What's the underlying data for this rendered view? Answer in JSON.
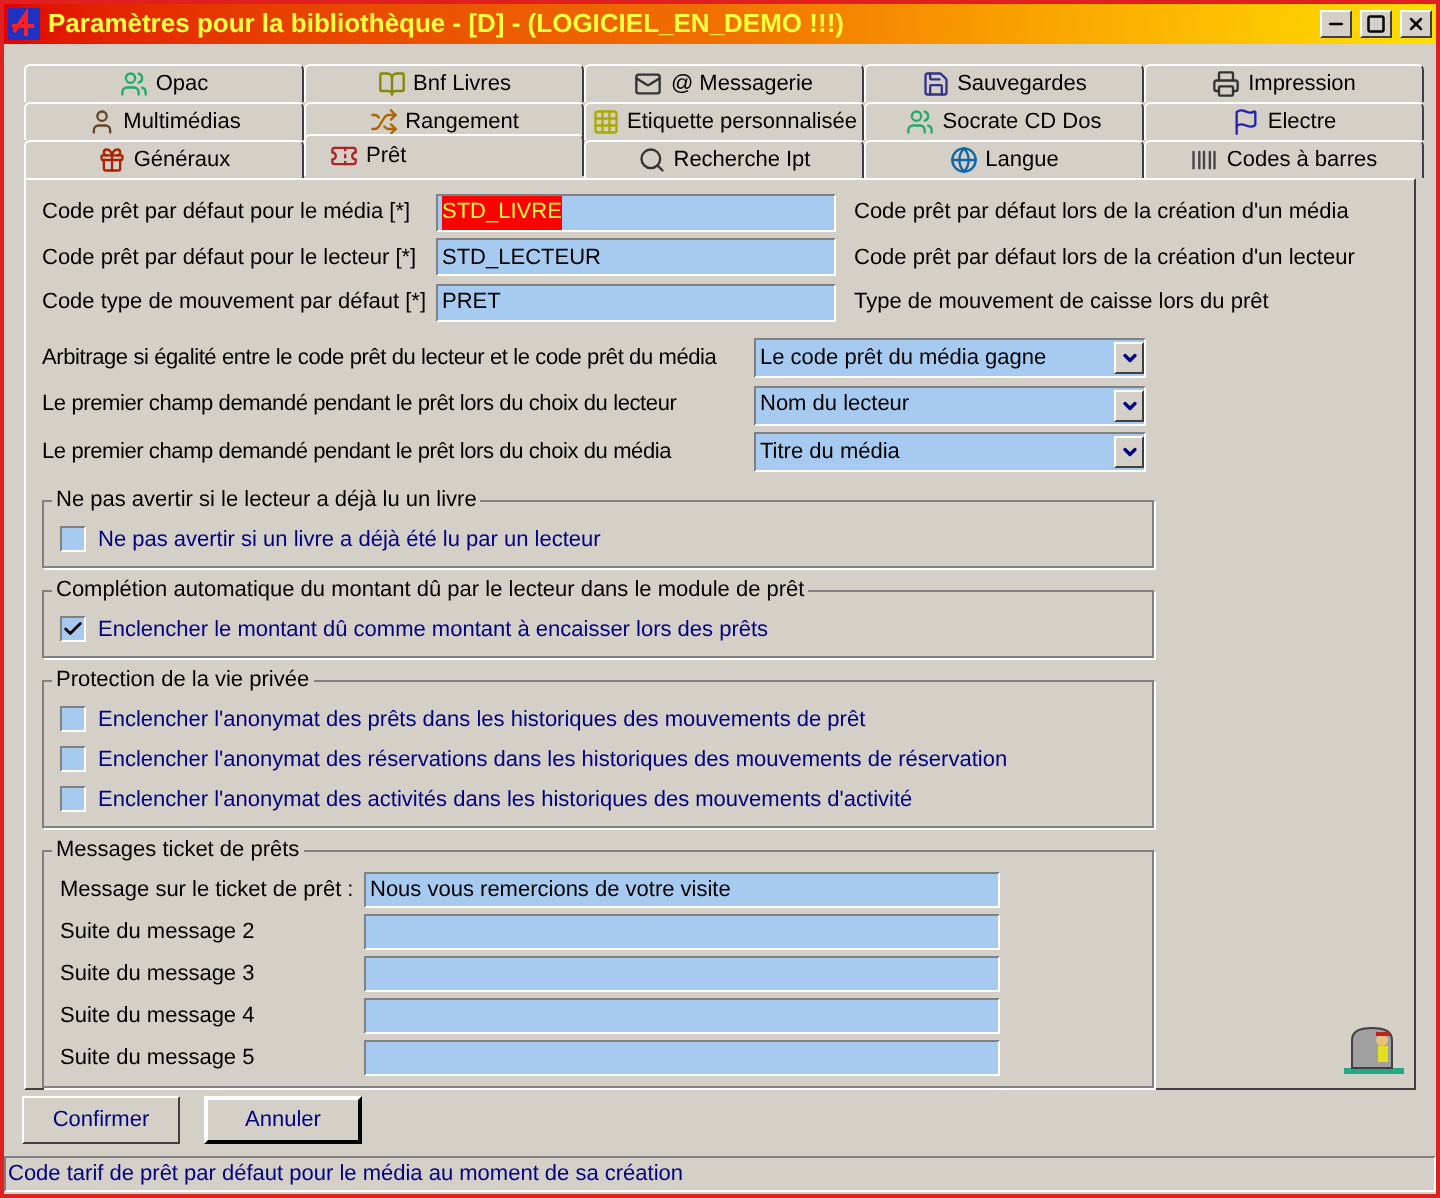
{
  "window": {
    "title": "Paramètres pour la bibliothèque - [D] - (LOGICIEL_EN_DEMO !!!)"
  },
  "tab_rows": [
    [
      {
        "label": "Opac",
        "selected": false
      },
      {
        "label": "Bnf Livres",
        "selected": false
      },
      {
        "label": "@ Messagerie",
        "selected": false
      },
      {
        "label": "Sauvegardes",
        "selected": false
      },
      {
        "label": "Impression",
        "selected": false
      }
    ],
    [
      {
        "label": "Multimédias",
        "selected": false
      },
      {
        "label": "Rangement",
        "selected": false
      },
      {
        "label": "Etiquette personnalisée",
        "selected": false
      },
      {
        "label": "Socrate CD Dos",
        "selected": false
      },
      {
        "label": "Electre",
        "selected": false
      }
    ],
    [
      {
        "label": "Généraux",
        "selected": false
      },
      {
        "label": "Prêt",
        "selected": true
      },
      {
        "label": "Recherche Ipt",
        "selected": false
      },
      {
        "label": "Langue",
        "selected": false
      },
      {
        "label": "Codes à barres",
        "selected": false
      }
    ]
  ],
  "code_fields": [
    {
      "label": "Code prêt par défaut pour le média [*]",
      "value": "STD_LIVRE",
      "highlighted": true,
      "description": "Code prêt par défaut lors de la création d'un média"
    },
    {
      "label": "Code prêt par défaut pour le lecteur [*]",
      "value": "STD_LECTEUR",
      "highlighted": false,
      "description": "Code prêt par défaut lors de la création d'un lecteur"
    },
    {
      "label": "Code type de mouvement par défaut [*]",
      "value": "PRET",
      "highlighted": false,
      "description": "Type de mouvement de caisse lors du prêt"
    }
  ],
  "dropdowns": [
    {
      "label": "Arbitrage si égalité entre le code prêt du lecteur et le code prêt du média",
      "value": "Le code prêt du média gagne"
    },
    {
      "label": "Le premier champ demandé pendant le prêt lors du choix du lecteur",
      "value": "Nom du lecteur"
    },
    {
      "label": "Le premier champ demandé pendant le prêt lors du choix du média",
      "value": "Titre du média"
    }
  ],
  "groups": [
    {
      "title": "Ne pas avertir si le lecteur a déjà lu un livre",
      "checkboxes": [
        {
          "label": "Ne pas avertir si un livre a déjà été lu par un lecteur",
          "checked": false
        }
      ]
    },
    {
      "title": "Complétion automatique du montant dû par le lecteur dans le module de prêt",
      "checkboxes": [
        {
          "label": "Enclencher le montant dû comme montant à encaisser lors des prêts",
          "checked": true
        }
      ]
    },
    {
      "title": "Protection de la vie privée",
      "checkboxes": [
        {
          "label": "Enclencher l'anonymat des prêts dans les historiques des mouvements de prêt",
          "checked": false
        },
        {
          "label": "Enclencher l'anonymat des réservations dans les historiques des mouvements de réservation",
          "checked": false
        },
        {
          "label": "Enclencher l'anonymat des activités dans les historiques des mouvements d'activité",
          "checked": false
        }
      ]
    }
  ],
  "ticket_messages": {
    "title": "Messages ticket de prêts",
    "fields": [
      {
        "label": "Message sur le ticket de prêt :",
        "value": "Nous vous remercions de votre visite"
      },
      {
        "label": "Suite du message 2"
      },
      {
        "label": "Suite du message 3"
      },
      {
        "label": "Suite du message 4"
      },
      {
        "label": "Suite du message 5"
      }
    ]
  },
  "buttons": [
    "Confirmer",
    "Annuler"
  ],
  "status_bar": "Code tarif de prêt par défaut pour le média au moment de sa création"
}
